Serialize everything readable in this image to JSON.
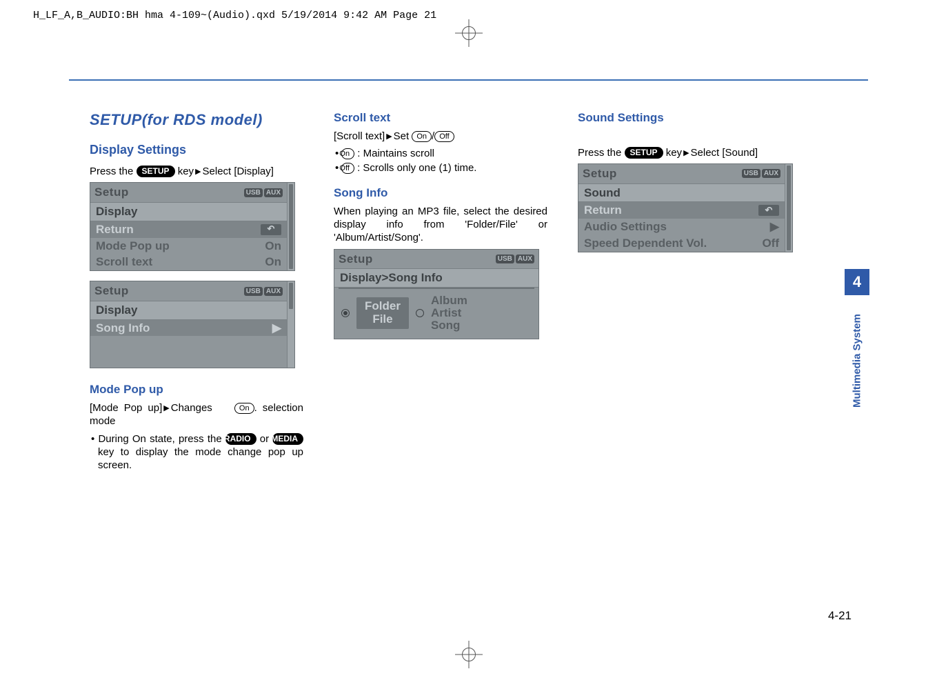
{
  "print_header": "H_LF_A,B_AUDIO:BH hma 4-109~(Audio).qxd  5/19/2014  9:42 AM  Page 21",
  "page_number": "4-21",
  "side_tab": {
    "num": "4",
    "label": "Multimedia System"
  },
  "keys": {
    "setup": "SETUP",
    "radio": "RADIO",
    "media": "MEDIA"
  },
  "pills": {
    "on": "On",
    "off": "Off"
  },
  "col1": {
    "h1": "SETUP(for RDS model)",
    "h2_display": "Display Settings",
    "press_pre": "Press the ",
    "press_post": " key",
    "select_display": "Select [Display]",
    "screen1": {
      "title": "Setup",
      "badges": [
        "USB",
        "AUX"
      ],
      "band": "Display",
      "rows": [
        {
          "label": "Return",
          "type": "back"
        },
        {
          "label": "Mode Pop up",
          "val": "On"
        },
        {
          "label": "Scroll text",
          "val": "On"
        }
      ]
    },
    "screen2": {
      "title": "Setup",
      "badges": [
        "USB",
        "AUX"
      ],
      "band": "Display",
      "rows": [
        {
          "label": "Song Info",
          "type": "arrow"
        }
      ]
    },
    "h3_mode": "Mode Pop up",
    "mode_line_pre": "[Mode Pop up]",
    "mode_line_mid": "Changes ",
    "mode_line_post": ". selection mode",
    "mode_bullet_pre": "During On state, press the ",
    "mode_bullet_mid": " or ",
    "mode_bullet_post": " key to display the mode change pop up screen."
  },
  "col2": {
    "h3_scroll": "Scroll text",
    "scroll_line_pre": "[Scroll text]",
    "scroll_set": "Set ",
    "scroll_slash": "/",
    "scroll_b1": " : Maintains scroll",
    "scroll_b2": " : Scrolls only one (1) time.",
    "h3_song": "Song Info",
    "song_para": "When playing an MP3 file, select the desired display info from 'Folder/File' or 'Album/Artist/Song'.",
    "screen": {
      "title": "Setup",
      "badges": [
        "USB",
        "AUX"
      ],
      "band": "Display>Song Info",
      "opt1_line1": "Folder",
      "opt1_line2": "File",
      "opt2_line1": "Album",
      "opt2_line2": "Artist",
      "opt2_line3": "Song"
    }
  },
  "col3": {
    "h3_sound": "Sound Settings",
    "press_pre": "Press the ",
    "press_post": " key",
    "select_sound": "Select [Sound]",
    "screen": {
      "title": "Setup",
      "badges": [
        "USB",
        "AUX"
      ],
      "band": "Sound",
      "rows": [
        {
          "label": "Return",
          "type": "back"
        },
        {
          "label": "Audio Settings",
          "type": "arrow"
        },
        {
          "label": "Speed Dependent Vol.",
          "val": "Off"
        }
      ]
    }
  }
}
